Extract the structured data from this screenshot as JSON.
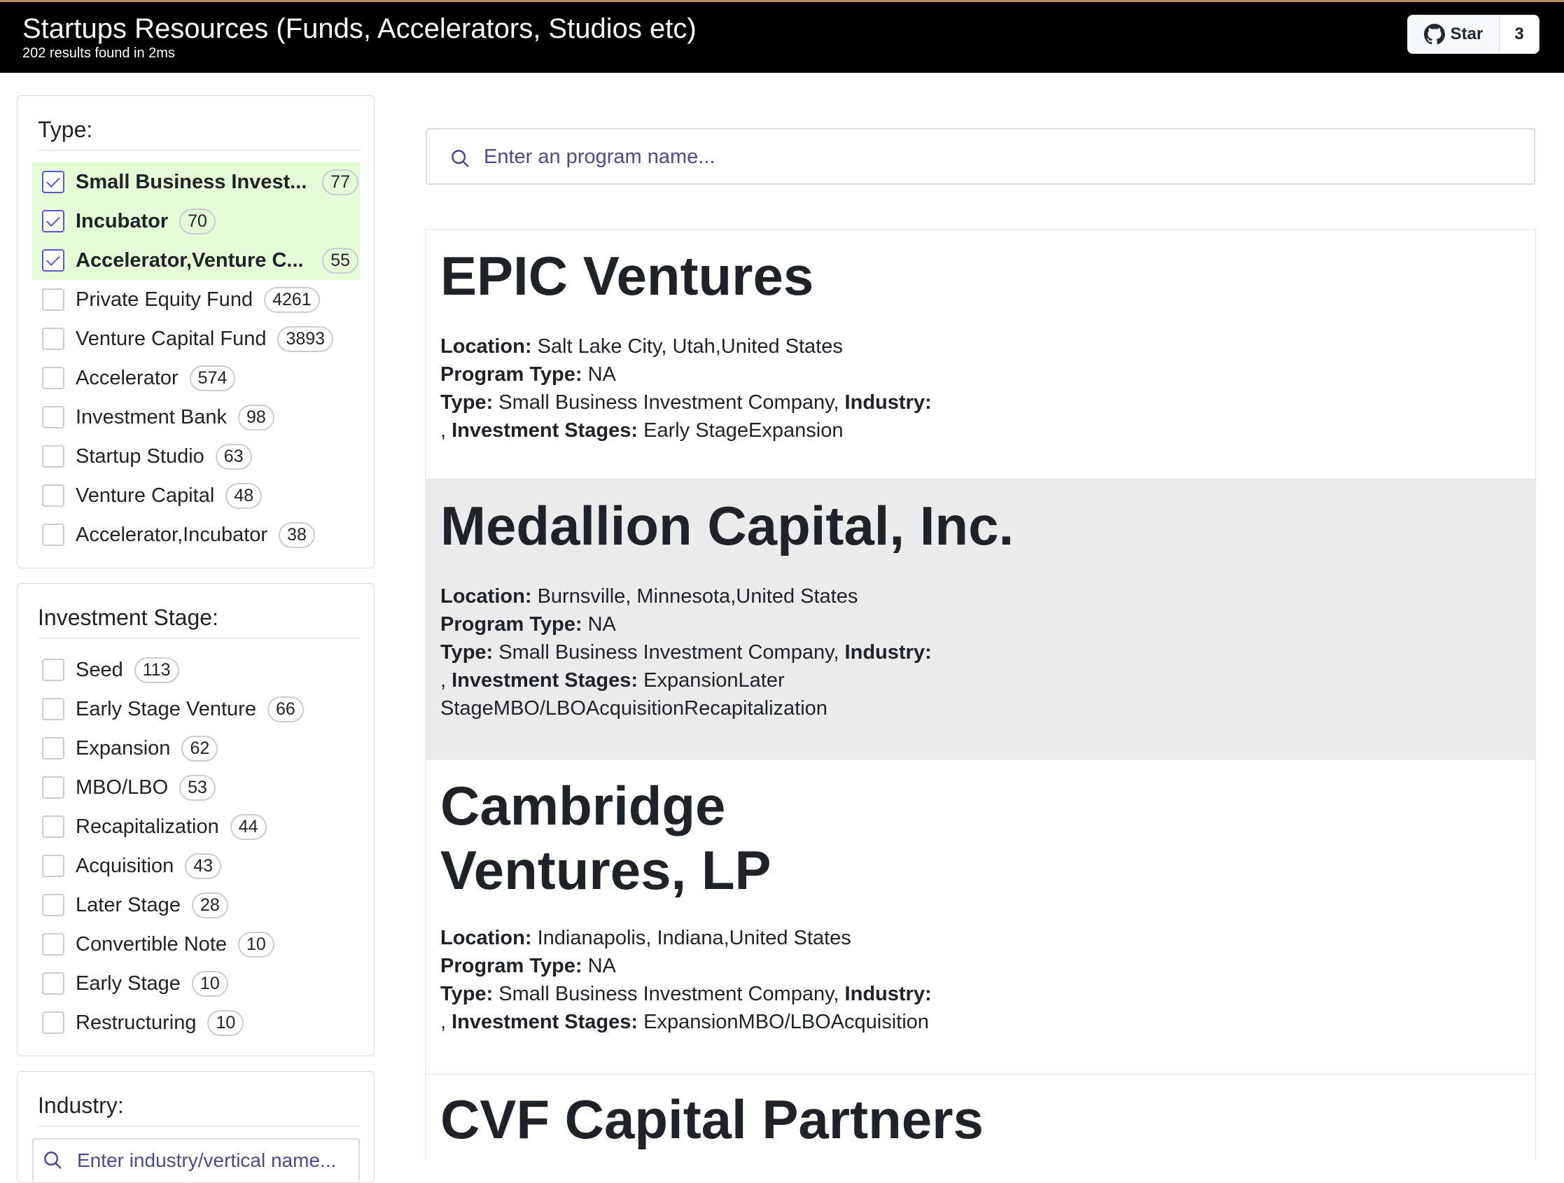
{
  "header": {
    "title": "Startups Resources (Funds, Accelerators, Studios etc)",
    "subtitle": "202 results found in 2ms",
    "github": {
      "label": "Star",
      "count": "3"
    }
  },
  "filters": {
    "type": {
      "title": "Type:",
      "items": [
        {
          "label": "Small Business Invest...",
          "count": "77",
          "checked": true
        },
        {
          "label": "Incubator",
          "count": "70",
          "checked": true
        },
        {
          "label": "Accelerator,Venture C...",
          "count": "55",
          "checked": true
        },
        {
          "label": "Private Equity Fund",
          "count": "4261",
          "checked": false
        },
        {
          "label": "Venture Capital Fund",
          "count": "3893",
          "checked": false
        },
        {
          "label": "Accelerator",
          "count": "574",
          "checked": false
        },
        {
          "label": "Investment Bank",
          "count": "98",
          "checked": false
        },
        {
          "label": "Startup Studio",
          "count": "63",
          "checked": false
        },
        {
          "label": "Venture Capital",
          "count": "48",
          "checked": false
        },
        {
          "label": "Accelerator,Incubator",
          "count": "38",
          "checked": false
        }
      ]
    },
    "stage": {
      "title": "Investment Stage:",
      "items": [
        {
          "label": "Seed",
          "count": "113"
        },
        {
          "label": "Early Stage Venture",
          "count": "66"
        },
        {
          "label": "Expansion",
          "count": "62"
        },
        {
          "label": "MBO/LBO",
          "count": "53"
        },
        {
          "label": "Recapitalization",
          "count": "44"
        },
        {
          "label": "Acquisition",
          "count": "43"
        },
        {
          "label": "Later Stage",
          "count": "28"
        },
        {
          "label": "Convertible Note",
          "count": "10"
        },
        {
          "label": "Early Stage",
          "count": "10"
        },
        {
          "label": "Restructuring",
          "count": "10"
        }
      ]
    },
    "industry": {
      "title": "Industry:",
      "placeholder": "Enter industry/vertical name..."
    }
  },
  "search": {
    "placeholder": "Enter an program name..."
  },
  "labels": {
    "location": "Location:",
    "program_type": "Program Type:",
    "type": "Type:",
    "industry": "Industry:",
    "stages": "Investment Stages:"
  },
  "results": [
    {
      "name": "EPIC Ventures",
      "location": "Salt Lake City, Utah,United States",
      "program_type": "NA",
      "type": "Small Business Investment Company,",
      "stages": "Early StageExpansion"
    },
    {
      "name": "Medallion Capital, Inc.",
      "location": "Burnsville, Minnesota,United States",
      "program_type": "NA",
      "type": "Small Business Investment Company,",
      "stages": "ExpansionLater StageMBO/LBOAcquisitionRecapitalization"
    },
    {
      "name": "Cambridge Ventures, LP",
      "location": "Indianapolis, Indiana,United States",
      "program_type": "NA",
      "type": "Small Business Investment Company,",
      "stages": "ExpansionMBO/LBOAcquisition"
    },
    {
      "name": "CVF Capital Partners"
    }
  ],
  "colors": {
    "selected_bg": "#e4fbd5",
    "checkbox_accent": "#5b57c8",
    "alt_row": "#ebebeb"
  }
}
